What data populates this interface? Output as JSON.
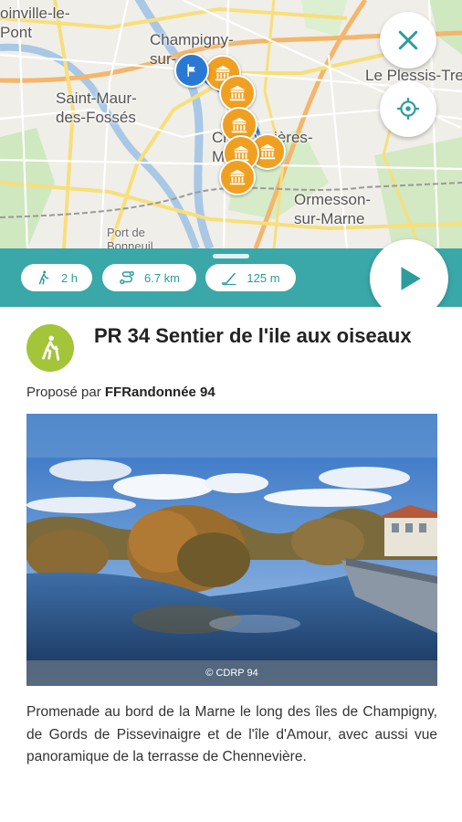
{
  "map": {
    "labels": {
      "joinville": "oinville-le-\nPont",
      "champigny": "Champigny-\nsur-",
      "plessis": "Le Plessis-Tre",
      "saint_maur": "Saint-Maur-\ndes-Fossés",
      "chennevieres": "Chennevières-\nMarne",
      "ormesson": "Ormesson-\nsur-Marne",
      "port": "Port de\nBonneuil"
    },
    "close_icon": "close-icon",
    "locate_icon": "crosshair-icon",
    "marker_icon": "monument-icon",
    "flag_icon": "flag-icon"
  },
  "stats": {
    "duration": "2 h",
    "distance": "6.7 km",
    "elevation": "125 m",
    "duration_icon": "hiker-icon",
    "distance_icon": "route-icon",
    "elevation_icon": "elevation-icon",
    "play_icon": "play-icon"
  },
  "trail": {
    "title": "PR 34 Sentier de l'ile aux oiseaux",
    "proposed_by_label": "Proposé par",
    "proposer": "FFRandonnée 94",
    "photo_credit": "© CDRP 94",
    "description": "Promenade au bord de la Marne le long des îles de Champigny, de Gords de Pissevinaigre et de l'île d'Amour, avec aussi vue panoramique de la terrasse de Chennevière."
  },
  "colors": {
    "accent": "#3aa7a8",
    "marker": "#f0a020",
    "flag": "#2979d4",
    "hike_badge": "#a4c43a"
  }
}
